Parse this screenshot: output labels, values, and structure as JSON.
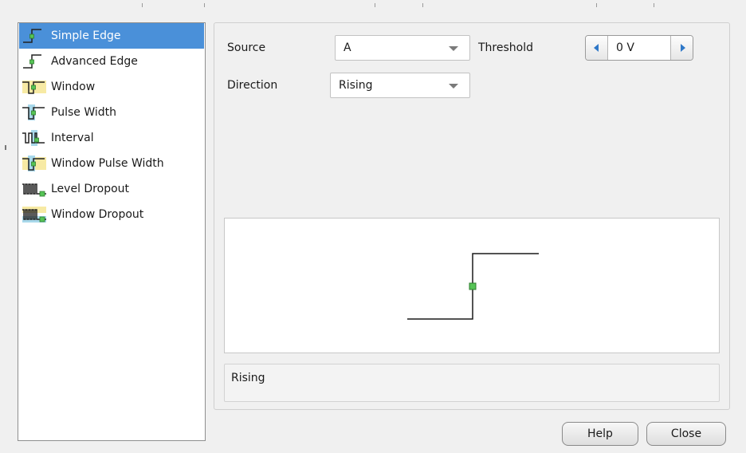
{
  "trigger_types": [
    {
      "label": "Simple Edge",
      "icon": "simple-edge-icon",
      "selected": true
    },
    {
      "label": "Advanced Edge",
      "icon": "advanced-edge-icon",
      "selected": false
    },
    {
      "label": "Window",
      "icon": "window-icon",
      "selected": false
    },
    {
      "label": "Pulse Width",
      "icon": "pulse-width-icon",
      "selected": false
    },
    {
      "label": "Interval",
      "icon": "interval-icon",
      "selected": false
    },
    {
      "label": "Window Pulse Width",
      "icon": "window-pulse-width-icon",
      "selected": false
    },
    {
      "label": "Level Dropout",
      "icon": "level-dropout-icon",
      "selected": false
    },
    {
      "label": "Window Dropout",
      "icon": "window-dropout-icon",
      "selected": false
    }
  ],
  "settings": {
    "source_label": "Source",
    "source_value": "A",
    "direction_label": "Direction",
    "direction_value": "Rising",
    "threshold_label": "Threshold",
    "threshold_value": "0 V"
  },
  "description": "Rising",
  "buttons": {
    "help": "Help",
    "close": "Close"
  },
  "colors": {
    "selection": "#4a90d9",
    "trigger_marker": "#56c456",
    "highlight_band": "#a8d8ea",
    "window_band": "#f7eaa4",
    "spin_arrow": "#2f78c8"
  }
}
